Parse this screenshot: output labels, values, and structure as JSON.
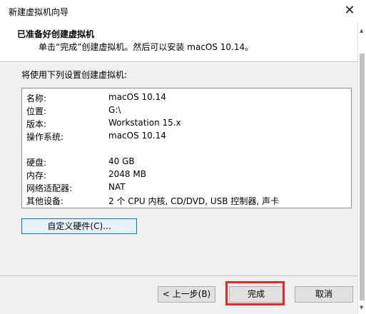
{
  "window": {
    "title": "新建虚拟机向导",
    "close_glyph": "✕"
  },
  "header": {
    "title": "已准备好创建虚拟机",
    "subtitle": "单击“完成”创建虚拟机。然后可以安装 macOS 10.14。"
  },
  "settings": {
    "label": "将使用下列设置创建虚拟机:",
    "rows": [
      {
        "key": "名称:",
        "value": "macOS 10.14"
      },
      {
        "key": "位置:",
        "value": "G:\\"
      },
      {
        "key": "版本:",
        "value": "Workstation 15.x"
      },
      {
        "key": "操作系统:",
        "value": "macOS 10.14"
      },
      {
        "key": "硬盘:",
        "value": "40 GB"
      },
      {
        "key": "内存:",
        "value": "2048 MB"
      },
      {
        "key": "网络适配器:",
        "value": "NAT"
      },
      {
        "key": "其他设备:",
        "value": "2 个 CPU 内核, CD/DVD, USB 控制器, 声卡"
      }
    ]
  },
  "buttons": {
    "customize": "自定义硬件(C)...",
    "back": "< 上一步(B)",
    "finish": "完成",
    "cancel": "取消"
  },
  "colors": {
    "highlight": "#ee2424",
    "focus_border": "#0078d7"
  }
}
